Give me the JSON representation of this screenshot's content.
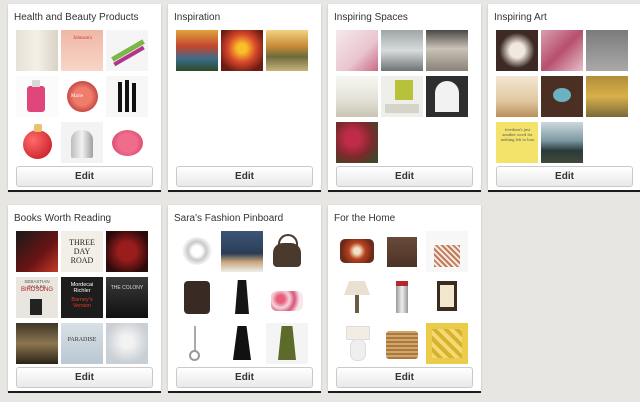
{
  "edit_label": "Edit",
  "boards": [
    {
      "title": "Health and Beauty Products"
    },
    {
      "title": "Inspiration"
    },
    {
      "title": "Inspiring Spaces"
    },
    {
      "title": "Inspiring Art"
    },
    {
      "title": "Books Worth Reading"
    },
    {
      "title": "Sara's Fashion Pinboard"
    },
    {
      "title": "For the Home"
    }
  ],
  "book_covers": {
    "three_day_road": "THREE DAY ROAD",
    "faulks_author": "SEBASTIAN FAULKS",
    "birdsong": "BIRDSONG",
    "richler_author": "Mordecai Richler",
    "barneys_version": "Barney's Version",
    "colony": "THE COLONY",
    "paradise": "PARADISE"
  },
  "art_text": {
    "freedom": "freedom's just another word for nothing left to lose"
  },
  "product_text": {
    "johnsons": "Johnson's",
    "marie": "Marie",
    "quote_o": "O"
  }
}
